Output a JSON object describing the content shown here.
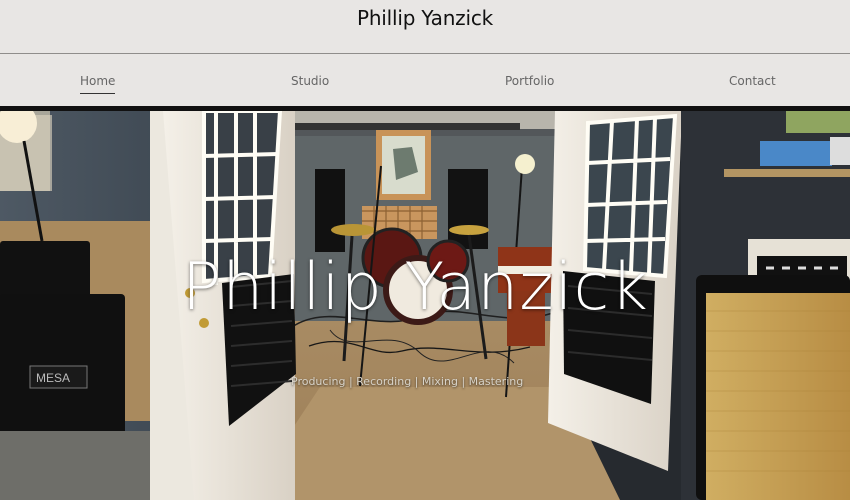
{
  "header": {
    "site_title": "Phillip Yanzick"
  },
  "nav": {
    "items": [
      {
        "label": "Home",
        "active": true
      },
      {
        "label": "Studio",
        "active": false
      },
      {
        "label": "Portfolio",
        "active": false
      },
      {
        "label": "Contact",
        "active": false
      }
    ]
  },
  "hero": {
    "title": "Phillip Yanzick",
    "subtitle": "Producing | Recording | Mixing | Mastering",
    "image_alt": "recording studio doorway"
  },
  "colors": {
    "page_background": "#e8e6e4",
    "text_primary": "#111111",
    "nav_text": "#666666",
    "hero_text": "#ffffff",
    "hero_subtitle": "#d7d2c7"
  }
}
